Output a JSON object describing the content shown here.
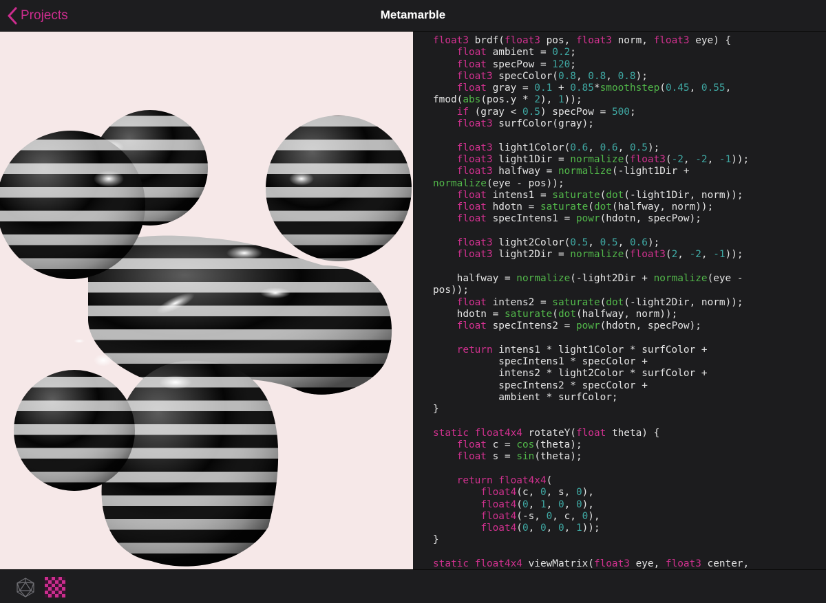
{
  "nav": {
    "back_label": "Projects",
    "title": "Metamarble"
  },
  "colors": {
    "accent": "#cc2d8e",
    "keyword": "#d1318f",
    "number": "#3fa9a4",
    "function": "#52b84a",
    "viewport_background": "#f6e8e8",
    "editor_background": "#1c1c1e"
  },
  "icons": {
    "back": "chevron-left-icon",
    "geometry": "icosahedron-icon",
    "texture": "checkerboard-icon"
  },
  "code": {
    "language": "Metal shading",
    "lines": [
      [
        [
          "float3",
          "kw"
        ],
        [
          " brdf(",
          "id"
        ],
        [
          "float3",
          "kw"
        ],
        [
          " pos, ",
          "id"
        ],
        [
          "float3",
          "kw"
        ],
        [
          " norm, ",
          "id"
        ],
        [
          "float3",
          "kw"
        ],
        [
          " eye) {",
          "id"
        ]
      ],
      [
        [
          "    ",
          "id"
        ],
        [
          "float",
          "kw"
        ],
        [
          " ambient = ",
          "id"
        ],
        [
          "0.2",
          "num"
        ],
        [
          ";",
          "id"
        ]
      ],
      [
        [
          "    ",
          "id"
        ],
        [
          "float",
          "kw"
        ],
        [
          " specPow = ",
          "id"
        ],
        [
          "120",
          "num"
        ],
        [
          ";",
          "id"
        ]
      ],
      [
        [
          "    ",
          "id"
        ],
        [
          "float3",
          "kw"
        ],
        [
          " specColor(",
          "id"
        ],
        [
          "0.8",
          "num"
        ],
        [
          ", ",
          "id"
        ],
        [
          "0.8",
          "num"
        ],
        [
          ", ",
          "id"
        ],
        [
          "0.8",
          "num"
        ],
        [
          ");",
          "id"
        ]
      ],
      [
        [
          "    ",
          "id"
        ],
        [
          "float",
          "kw"
        ],
        [
          " gray = ",
          "id"
        ],
        [
          "0.1",
          "num"
        ],
        [
          " + ",
          "id"
        ],
        [
          "0.85",
          "num"
        ],
        [
          "*",
          "id"
        ],
        [
          "smoothstep",
          "fn"
        ],
        [
          "(",
          "id"
        ],
        [
          "0.45",
          "num"
        ],
        [
          ", ",
          "id"
        ],
        [
          "0.55",
          "num"
        ],
        [
          ",",
          "id"
        ]
      ],
      [
        [
          "fmod(",
          "id"
        ],
        [
          "abs",
          "fn"
        ],
        [
          "(pos.y * ",
          "id"
        ],
        [
          "2",
          "num"
        ],
        [
          "), ",
          "id"
        ],
        [
          "1",
          "num"
        ],
        [
          "));",
          "id"
        ]
      ],
      [
        [
          "    ",
          "id"
        ],
        [
          "if",
          "kw"
        ],
        [
          " (gray < ",
          "id"
        ],
        [
          "0.5",
          "num"
        ],
        [
          ") specPow = ",
          "id"
        ],
        [
          "500",
          "num"
        ],
        [
          ";",
          "id"
        ]
      ],
      [
        [
          "    ",
          "id"
        ],
        [
          "float3",
          "kw"
        ],
        [
          " surfColor(gray);",
          "id"
        ]
      ],
      [],
      [
        [
          "    ",
          "id"
        ],
        [
          "float3",
          "kw"
        ],
        [
          " light1Color(",
          "id"
        ],
        [
          "0.6",
          "num"
        ],
        [
          ", ",
          "id"
        ],
        [
          "0.6",
          "num"
        ],
        [
          ", ",
          "id"
        ],
        [
          "0.5",
          "num"
        ],
        [
          ");",
          "id"
        ]
      ],
      [
        [
          "    ",
          "id"
        ],
        [
          "float3",
          "kw"
        ],
        [
          " light1Dir = ",
          "id"
        ],
        [
          "normalize",
          "fn"
        ],
        [
          "(",
          "id"
        ],
        [
          "float3",
          "kw"
        ],
        [
          "(",
          "id"
        ],
        [
          "-2",
          "num"
        ],
        [
          ", ",
          "id"
        ],
        [
          "-2",
          "num"
        ],
        [
          ", ",
          "id"
        ],
        [
          "-1",
          "num"
        ],
        [
          "));",
          "id"
        ]
      ],
      [
        [
          "    ",
          "id"
        ],
        [
          "float3",
          "kw"
        ],
        [
          " halfway = ",
          "id"
        ],
        [
          "normalize",
          "fn"
        ],
        [
          "(-light1Dir +",
          "id"
        ]
      ],
      [
        [
          "normalize",
          "fn"
        ],
        [
          "(eye - pos));",
          "id"
        ]
      ],
      [
        [
          "    ",
          "id"
        ],
        [
          "float",
          "kw"
        ],
        [
          " intens1 = ",
          "id"
        ],
        [
          "saturate",
          "fn"
        ],
        [
          "(",
          "id"
        ],
        [
          "dot",
          "fn"
        ],
        [
          "(-light1Dir, norm));",
          "id"
        ]
      ],
      [
        [
          "    ",
          "id"
        ],
        [
          "float",
          "kw"
        ],
        [
          " hdotn = ",
          "id"
        ],
        [
          "saturate",
          "fn"
        ],
        [
          "(",
          "id"
        ],
        [
          "dot",
          "fn"
        ],
        [
          "(halfway, norm));",
          "id"
        ]
      ],
      [
        [
          "    ",
          "id"
        ],
        [
          "float",
          "kw"
        ],
        [
          " specIntens1 = ",
          "id"
        ],
        [
          "powr",
          "fn"
        ],
        [
          "(hdotn, specPow);",
          "id"
        ]
      ],
      [],
      [
        [
          "    ",
          "id"
        ],
        [
          "float3",
          "kw"
        ],
        [
          " light2Color(",
          "id"
        ],
        [
          "0.5",
          "num"
        ],
        [
          ", ",
          "id"
        ],
        [
          "0.5",
          "num"
        ],
        [
          ", ",
          "id"
        ],
        [
          "0.6",
          "num"
        ],
        [
          ");",
          "id"
        ]
      ],
      [
        [
          "    ",
          "id"
        ],
        [
          "float3",
          "kw"
        ],
        [
          " light2Dir = ",
          "id"
        ],
        [
          "normalize",
          "fn"
        ],
        [
          "(",
          "id"
        ],
        [
          "float3",
          "kw"
        ],
        [
          "(",
          "id"
        ],
        [
          "2",
          "num"
        ],
        [
          ", ",
          "id"
        ],
        [
          "-2",
          "num"
        ],
        [
          ", ",
          "id"
        ],
        [
          "-1",
          "num"
        ],
        [
          "));",
          "id"
        ]
      ],
      [],
      [
        [
          "    halfway = ",
          "id"
        ],
        [
          "normalize",
          "fn"
        ],
        [
          "(-light2Dir + ",
          "id"
        ],
        [
          "normalize",
          "fn"
        ],
        [
          "(eye -",
          "id"
        ]
      ],
      [
        [
          "pos));",
          "id"
        ]
      ],
      [
        [
          "    ",
          "id"
        ],
        [
          "float",
          "kw"
        ],
        [
          " intens2 = ",
          "id"
        ],
        [
          "saturate",
          "fn"
        ],
        [
          "(",
          "id"
        ],
        [
          "dot",
          "fn"
        ],
        [
          "(-light2Dir, norm));",
          "id"
        ]
      ],
      [
        [
          "    hdotn = ",
          "id"
        ],
        [
          "saturate",
          "fn"
        ],
        [
          "(",
          "id"
        ],
        [
          "dot",
          "fn"
        ],
        [
          "(halfway, norm));",
          "id"
        ]
      ],
      [
        [
          "    ",
          "id"
        ],
        [
          "float",
          "kw"
        ],
        [
          " specIntens2 = ",
          "id"
        ],
        [
          "powr",
          "fn"
        ],
        [
          "(hdotn, specPow);",
          "id"
        ]
      ],
      [],
      [
        [
          "    ",
          "id"
        ],
        [
          "return",
          "kw"
        ],
        [
          " intens1 * light1Color * surfColor +",
          "id"
        ]
      ],
      [
        [
          "           specIntens1 * specColor +",
          "id"
        ]
      ],
      [
        [
          "           intens2 * light2Color * surfColor +",
          "id"
        ]
      ],
      [
        [
          "           specIntens2 * specColor +",
          "id"
        ]
      ],
      [
        [
          "           ambient * surfColor;",
          "id"
        ]
      ],
      [
        [
          "}",
          "id"
        ]
      ],
      [],
      [
        [
          "static",
          "kw"
        ],
        [
          " ",
          "id"
        ],
        [
          "float4x4",
          "kw"
        ],
        [
          " rotateY(",
          "id"
        ],
        [
          "float",
          "kw"
        ],
        [
          " theta) {",
          "id"
        ]
      ],
      [
        [
          "    ",
          "id"
        ],
        [
          "float",
          "kw"
        ],
        [
          " c = ",
          "id"
        ],
        [
          "cos",
          "fn"
        ],
        [
          "(theta);",
          "id"
        ]
      ],
      [
        [
          "    ",
          "id"
        ],
        [
          "float",
          "kw"
        ],
        [
          " s = ",
          "id"
        ],
        [
          "sin",
          "fn"
        ],
        [
          "(theta);",
          "id"
        ]
      ],
      [],
      [
        [
          "    ",
          "id"
        ],
        [
          "return",
          "kw"
        ],
        [
          " ",
          "id"
        ],
        [
          "float4x4",
          "kw"
        ],
        [
          "(",
          "id"
        ]
      ],
      [
        [
          "        ",
          "id"
        ],
        [
          "float4",
          "kw"
        ],
        [
          "(c, ",
          "id"
        ],
        [
          "0",
          "num"
        ],
        [
          ", s, ",
          "id"
        ],
        [
          "0",
          "num"
        ],
        [
          "),",
          "id"
        ]
      ],
      [
        [
          "        ",
          "id"
        ],
        [
          "float4",
          "kw"
        ],
        [
          "(",
          "id"
        ],
        [
          "0",
          "num"
        ],
        [
          ", ",
          "id"
        ],
        [
          "1",
          "num"
        ],
        [
          ", ",
          "id"
        ],
        [
          "0",
          "num"
        ],
        [
          ", ",
          "id"
        ],
        [
          "0",
          "num"
        ],
        [
          "),",
          "id"
        ]
      ],
      [
        [
          "        ",
          "id"
        ],
        [
          "float4",
          "kw"
        ],
        [
          "(-s, ",
          "id"
        ],
        [
          "0",
          "num"
        ],
        [
          ", c, ",
          "id"
        ],
        [
          "0",
          "num"
        ],
        [
          "),",
          "id"
        ]
      ],
      [
        [
          "        ",
          "id"
        ],
        [
          "float4",
          "kw"
        ],
        [
          "(",
          "id"
        ],
        [
          "0",
          "num"
        ],
        [
          ", ",
          "id"
        ],
        [
          "0",
          "num"
        ],
        [
          ", ",
          "id"
        ],
        [
          "0",
          "num"
        ],
        [
          ", ",
          "id"
        ],
        [
          "1",
          "num"
        ],
        [
          "));",
          "id"
        ]
      ],
      [
        [
          "}",
          "id"
        ]
      ],
      [],
      [
        [
          "static",
          "kw"
        ],
        [
          " ",
          "id"
        ],
        [
          "float4x4",
          "kw"
        ],
        [
          " viewMatrix(",
          "id"
        ],
        [
          "float3",
          "kw"
        ],
        [
          " eye, ",
          "id"
        ],
        [
          "float3",
          "kw"
        ],
        [
          " center,",
          "id"
        ]
      ]
    ]
  }
}
